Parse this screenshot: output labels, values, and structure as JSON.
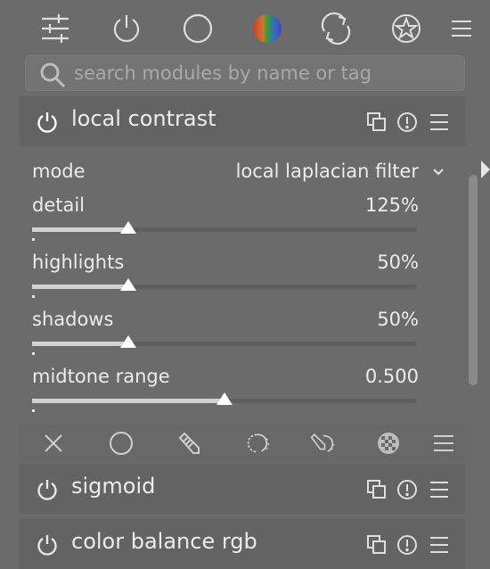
{
  "toolbar": {
    "icons": [
      "sliders-icon",
      "power-icon",
      "circle-icon",
      "color-wheel-icon",
      "refresh-icon",
      "favorite-star-icon",
      "hamburger-menu-icon"
    ]
  },
  "search": {
    "placeholder": "search modules by name or tag",
    "value": ""
  },
  "modules": {
    "local_contrast": {
      "title": "local contrast",
      "mode_label": "mode",
      "mode_value": "local laplacian filter",
      "sliders": [
        {
          "label": "detail",
          "value_text": "125%",
          "fill_fraction": 0.24
        },
        {
          "label": "highlights",
          "value_text": "50%",
          "fill_fraction": 0.24
        },
        {
          "label": "shadows",
          "value_text": "50%",
          "fill_fraction": 0.24
        },
        {
          "label": "midtone range",
          "value_text": "0.500",
          "fill_fraction": 0.5
        }
      ]
    },
    "sigmoid": {
      "title": "sigmoid"
    },
    "color_balance_rgb": {
      "title": "color balance rgb"
    }
  },
  "blend_strip": {
    "icons": [
      "off-x-icon",
      "uniform-circle-icon",
      "drawn-mask-pencil-icon",
      "parametric-mask-icon",
      "drawn-parametric-mask-icon",
      "raster-mask-icon",
      "menu-icon"
    ]
  },
  "colors": {
    "background": "#6b6b6b",
    "header": "#636363",
    "text": "#ececec",
    "accent_fill": "#d2d2d2"
  }
}
